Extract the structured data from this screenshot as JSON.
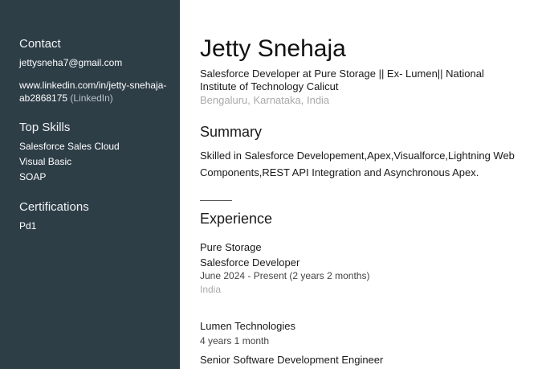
{
  "sidebar": {
    "contact_heading": "Contact",
    "email": "jettysneha7@gmail.com",
    "linkedin_line1": "www.linkedin.com/in/jetty-snehaja-",
    "linkedin_line2": "ab2868175",
    "linkedin_suffix": "(LinkedIn)",
    "skills_heading": "Top Skills",
    "skills": [
      "Salesforce Sales Cloud",
      "Visual Basic",
      "SOAP"
    ],
    "certifications_heading": "Certifications",
    "certifications": [
      "Pd1"
    ]
  },
  "profile": {
    "name": "Jetty Snehaja",
    "headline_line1": "Salesforce Developer at Pure Storage || Ex- Lumen|| National",
    "headline_line2": "Institute of Technology Calicut",
    "location": "Bengaluru, Karnataka, India"
  },
  "summary": {
    "title": "Summary",
    "line1": "Skilled in Salesforce Developement,Apex,Visualforce,Lightning  Web",
    "line2": "Components,REST API Integration and Asynchronous Apex."
  },
  "experience": {
    "title": "Experience",
    "jobs": [
      {
        "company": "Pure Storage",
        "role": "Salesforce Developer",
        "dates": "June 2024 - Present (2 years 2 months)",
        "location": "India"
      },
      {
        "company": "Lumen Technologies",
        "duration": "4 years 1 month",
        "role": "Senior Software Development Engineer"
      }
    ]
  }
}
